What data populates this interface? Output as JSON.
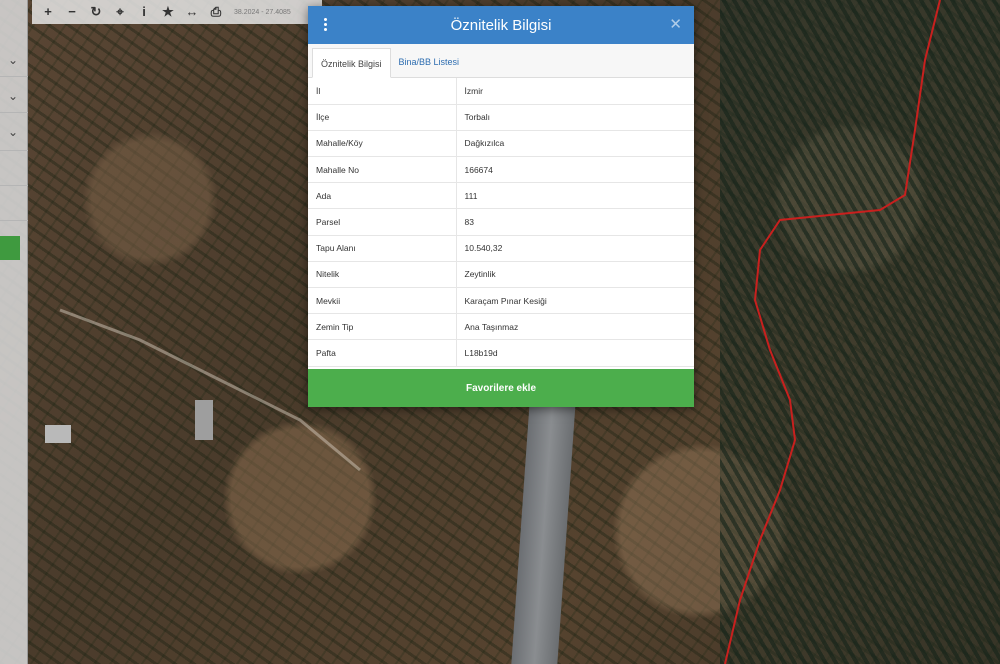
{
  "toolbar": {
    "tools": [
      {
        "icon": "plus-icon",
        "glyph": "+"
      },
      {
        "icon": "minus-icon",
        "glyph": "−"
      },
      {
        "icon": "refresh-icon",
        "glyph": "↻"
      },
      {
        "icon": "locate-icon",
        "glyph": "⌖"
      },
      {
        "icon": "info-icon",
        "glyph": "i"
      },
      {
        "icon": "star-icon",
        "glyph": "★"
      },
      {
        "icon": "measure-icon",
        "glyph": "↔"
      },
      {
        "icon": "print-icon",
        "glyph": "⎙"
      }
    ],
    "coords_text": "38.2024 - 27.4085"
  },
  "modal": {
    "title": "Öznitelik Bilgisi",
    "menu_icon": "vertical-dots-icon",
    "close_icon": "close-icon",
    "tabs": [
      {
        "label": "Öznitelik Bilgisi",
        "active": true
      },
      {
        "label": "Bina/BB Listesi",
        "active": false
      }
    ],
    "rows": [
      {
        "key": "İl",
        "value": "İzmir"
      },
      {
        "key": "İlçe",
        "value": "Torbalı"
      },
      {
        "key": "Mahalle/Köy",
        "value": "Dağkızılca"
      },
      {
        "key": "Mahalle No",
        "value": "166674"
      },
      {
        "key": "Ada",
        "value": "111"
      },
      {
        "key": "Parsel",
        "value": "83"
      },
      {
        "key": "Tapu Alanı",
        "value": "10.540,32"
      },
      {
        "key": "Nitelik",
        "value": "Zeytinlik"
      },
      {
        "key": "Mevkii",
        "value": "Karaçam Pınar Kesiği"
      },
      {
        "key": "Zemin Tip",
        "value": "Ana Taşınmaz"
      },
      {
        "key": "Pafta",
        "value": "L18b19d"
      }
    ],
    "favorite_button": "Favorilere ekle"
  },
  "colors": {
    "header_blue": "#3b82c8",
    "favorite_green": "#4cae4c",
    "boundary_red": "#c8201e"
  }
}
